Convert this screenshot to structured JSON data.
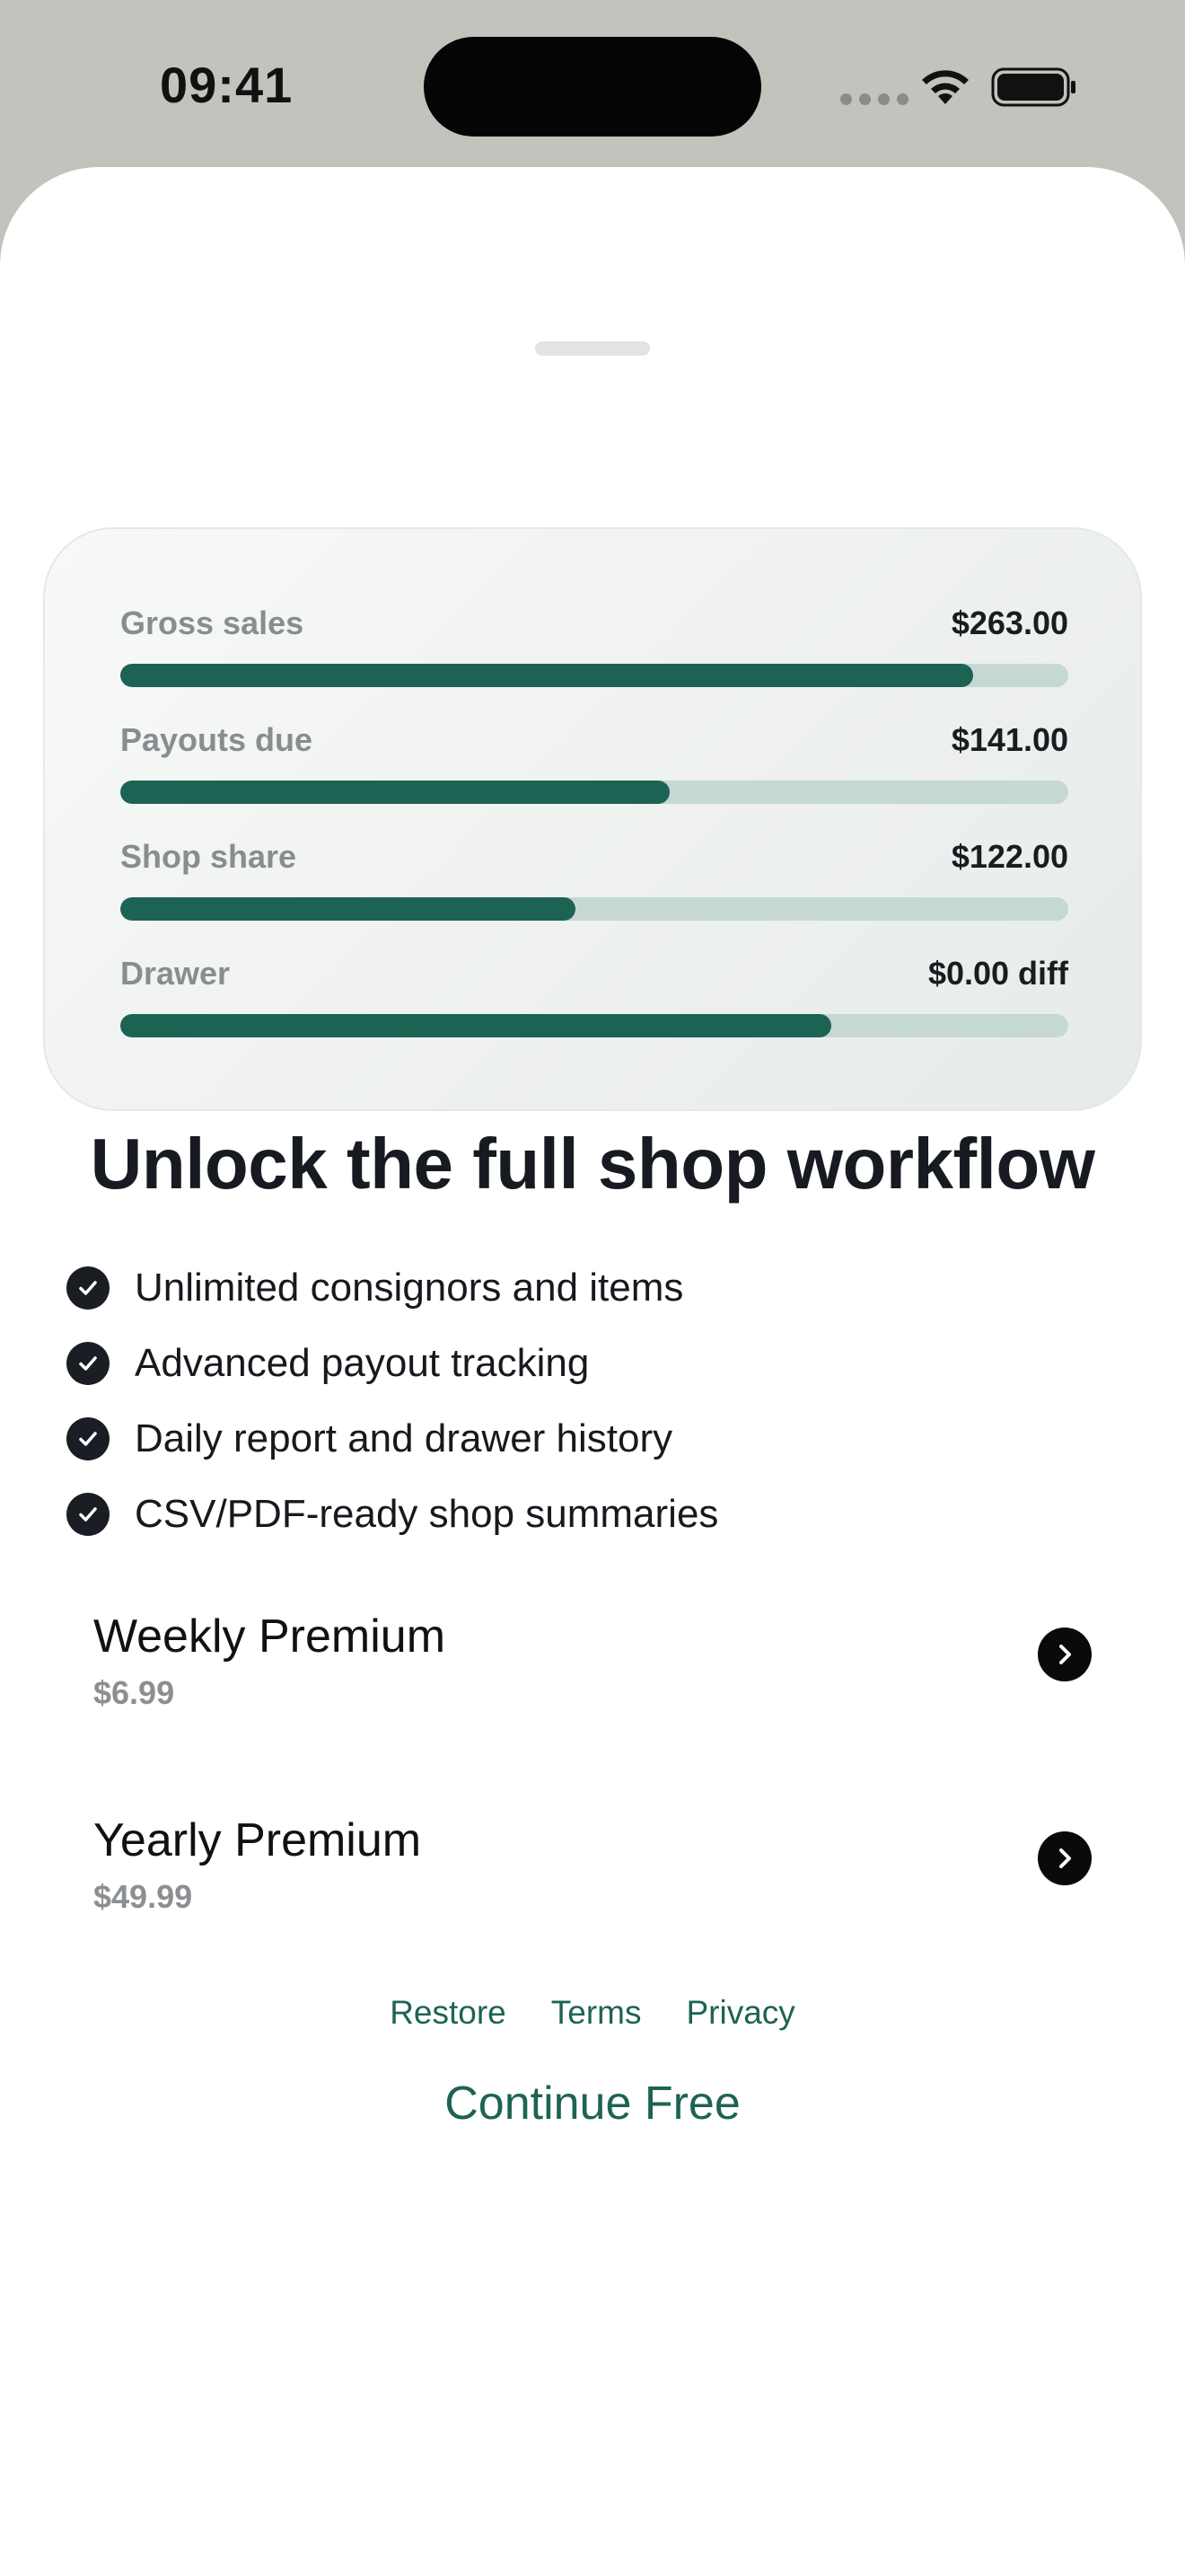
{
  "status_bar": {
    "time": "09:41"
  },
  "summary": {
    "metrics": [
      {
        "label": "Gross sales",
        "value": "$263.00",
        "fill_fraction": 0.9
      },
      {
        "label": "Payouts due",
        "value": "$141.00",
        "fill_fraction": 0.58
      },
      {
        "label": "Shop share",
        "value": "$122.00",
        "fill_fraction": 0.48
      },
      {
        "label": "Drawer",
        "value": "$0.00 diff",
        "fill_fraction": 0.75
      }
    ]
  },
  "headline": "Unlock the full shop workflow",
  "features": [
    "Unlimited consignors and items",
    "Advanced payout tracking",
    "Daily report and drawer history",
    "CSV/PDF-ready shop summaries"
  ],
  "plans": [
    {
      "name": "Weekly Premium",
      "price": "$6.99"
    },
    {
      "name": "Yearly Premium",
      "price": "$49.99"
    }
  ],
  "footer": {
    "restore": "Restore",
    "terms": "Terms",
    "privacy": "Privacy",
    "continue_free": "Continue Free"
  },
  "colors": {
    "accent": "#1d6354",
    "track": "#c6d8d4",
    "background": "#c1c3bd"
  },
  "icons": {
    "status": [
      "cellular-signal-icon",
      "wifi-icon",
      "battery-icon"
    ],
    "feature_bullet": "checkmark-circle-icon",
    "plan_action": "chevron-right-circle-icon"
  }
}
